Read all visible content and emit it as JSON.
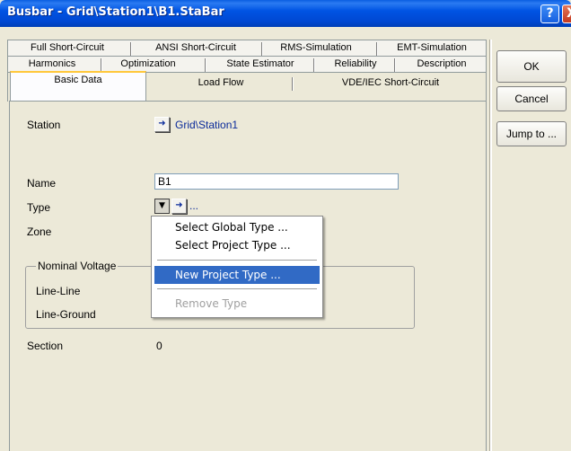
{
  "window": {
    "title": "Busbar - Grid\\Station1\\B1.StaBar",
    "help_glyph": "?",
    "close_glyph": "X"
  },
  "tabs": {
    "row1": [
      "Full Short-Circuit",
      "ANSI Short-Circuit",
      "RMS-Simulation",
      "EMT-Simulation"
    ],
    "row2": [
      "Harmonics",
      "Optimization",
      "State Estimator",
      "Reliability",
      "Description"
    ],
    "row3": [
      "Basic Data",
      "Load Flow",
      "VDE/IEC Short-Circuit"
    ],
    "active": "Basic Data"
  },
  "form": {
    "station_label": "Station",
    "station_value": "Grid\\Station1",
    "name_label": "Name",
    "name_value": "B1",
    "type_label": "Type",
    "type_ellipsis": "...",
    "zone_label": "Zone",
    "nominal_voltage_legend": "Nominal Voltage",
    "line_line_label": "Line-Line",
    "line_ground_label": "Line-Ground",
    "section_label": "Section",
    "section_value": "0"
  },
  "buttons": {
    "ok": "OK",
    "cancel": "Cancel",
    "jump_to": "Jump to ..."
  },
  "context_menu": {
    "items": [
      {
        "label": "Select Global Type ...",
        "state": "normal"
      },
      {
        "label": "Select Project Type ...",
        "state": "normal"
      },
      {
        "label": "New Project Type ...",
        "state": "highlighted"
      },
      {
        "label": "Remove Type",
        "state": "disabled"
      }
    ]
  },
  "icons": {
    "jump_arrow": "right-arrow-icon",
    "type_dropdown": "dropdown-icon"
  },
  "colors": {
    "titlebar": "#0054e3",
    "menu_highlight": "#316ac5",
    "dialog_bg": "#ece9d8"
  }
}
